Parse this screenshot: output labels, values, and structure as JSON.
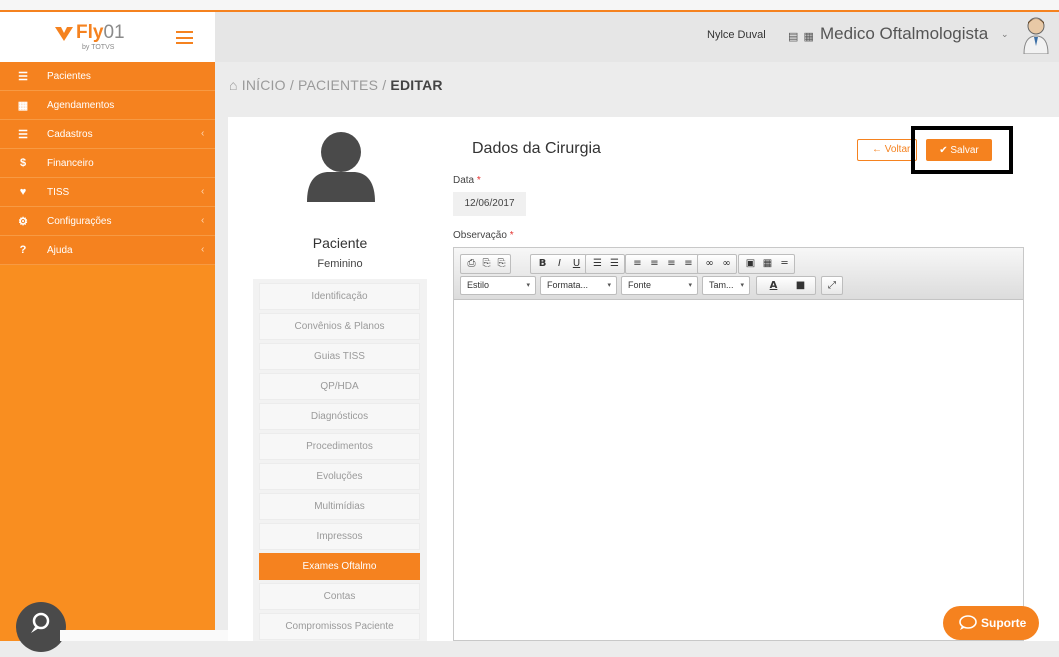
{
  "brand": {
    "logo_text_a": "Fly",
    "logo_text_b": "01",
    "logo_sub": "by TOTVS"
  },
  "header": {
    "user_name": "Nylce Duval",
    "role": "Medico Oftalmologista",
    "role_caret": "⌄"
  },
  "sidebar": {
    "items": [
      {
        "label": "Pacientes",
        "icon": "users-icon",
        "glyph": "☰",
        "chevron": ""
      },
      {
        "label": "Agendamentos",
        "icon": "calendar-icon",
        "glyph": "▦",
        "chevron": ""
      },
      {
        "label": "Cadastros",
        "icon": "list-icon",
        "glyph": "☰",
        "chevron": "‹"
      },
      {
        "label": "Financeiro",
        "icon": "dollar-icon",
        "glyph": "$",
        "chevron": ""
      },
      {
        "label": "TISS",
        "icon": "heartbeat-icon",
        "glyph": "♥",
        "chevron": "‹"
      },
      {
        "label": "Configurações",
        "icon": "gear-icon",
        "glyph": "⚙",
        "chevron": "‹"
      },
      {
        "label": "Ajuda",
        "icon": "question-icon",
        "glyph": "?",
        "chevron": "‹"
      }
    ]
  },
  "breadcrumb": {
    "home": "⌂ INÍCIO",
    "sep1": "/",
    "section": "PACIENTES",
    "sep2": "/",
    "current": "EDITAR"
  },
  "patient": {
    "title": "Paciente",
    "sex": "Feminino",
    "menu": [
      {
        "label": "Identificação",
        "active": false
      },
      {
        "label": "Convênios & Planos",
        "active": false
      },
      {
        "label": "Guias TISS",
        "active": false
      },
      {
        "label": "QP/HDA",
        "active": false
      },
      {
        "label": "Diagnósticos",
        "active": false
      },
      {
        "label": "Procedimentos",
        "active": false
      },
      {
        "label": "Evoluções",
        "active": false
      },
      {
        "label": "Multimídias",
        "active": false
      },
      {
        "label": "Impressos",
        "active": false
      },
      {
        "label": "Exames Oftalmo",
        "active": true
      },
      {
        "label": "Contas",
        "active": false
      },
      {
        "label": "Compromissos Paciente",
        "active": false
      }
    ]
  },
  "form": {
    "section_title": "Dados da Cirurgia",
    "voltar_label": "← Voltar",
    "salvar_label": "✔ Salvar",
    "data_label": "Data",
    "required_mark": "*",
    "data_value": "12/06/2017",
    "obs_label": "Observação"
  },
  "editor": {
    "row1": [
      {
        "name": "print-icon",
        "glyph": "⎙"
      },
      {
        "name": "paste-icon",
        "glyph": "⎘"
      },
      {
        "name": "paste-text-icon",
        "glyph": "⎘"
      },
      {
        "name": "bold-button",
        "glyph": "B"
      },
      {
        "name": "italic-button",
        "glyph": "I"
      },
      {
        "name": "underline-button",
        "glyph": "U"
      },
      {
        "name": "numbered-list-icon",
        "glyph": "☰"
      },
      {
        "name": "bullet-list-icon",
        "glyph": "☰"
      },
      {
        "name": "align-left-icon",
        "glyph": "≡"
      },
      {
        "name": "align-center-icon",
        "glyph": "≡"
      },
      {
        "name": "align-right-icon",
        "glyph": "≡"
      },
      {
        "name": "justify-icon",
        "glyph": "≡"
      },
      {
        "name": "link-icon",
        "glyph": "∞"
      },
      {
        "name": "unlink-icon",
        "glyph": "∞"
      },
      {
        "name": "image-icon",
        "glyph": "▣"
      },
      {
        "name": "table-icon",
        "glyph": "▦"
      },
      {
        "name": "horizontal-rule-icon",
        "glyph": "═"
      }
    ],
    "combos": [
      {
        "name": "style-select",
        "label": "Estilo"
      },
      {
        "name": "format-select",
        "label": "Formata..."
      },
      {
        "name": "font-select",
        "label": "Fonte"
      },
      {
        "name": "size-select",
        "label": "Tam..."
      }
    ],
    "text_color": "A",
    "bg_color": "■",
    "maximize": "⤢",
    "caret": "▾"
  },
  "support": {
    "label": "Suporte"
  },
  "colors": {
    "accent": "#f5821f",
    "sidebar": "#f98e20"
  }
}
